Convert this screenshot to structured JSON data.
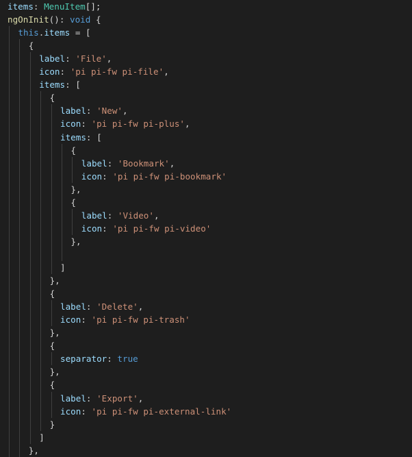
{
  "editor": {
    "language": "typescript",
    "theme": "dark",
    "lines": [
      {
        "indent": 0,
        "tokens": [
          {
            "t": "items",
            "c": "prop"
          },
          {
            "t": ": ",
            "c": "punc"
          },
          {
            "t": "MenuItem",
            "c": "type"
          },
          {
            "t": "[];",
            "c": "punc"
          }
        ]
      },
      {
        "indent": 0,
        "tokens": [
          {
            "t": "ngOnInit",
            "c": "func"
          },
          {
            "t": "(): ",
            "c": "punc"
          },
          {
            "t": "void",
            "c": "kw"
          },
          {
            "t": " {",
            "c": "punc"
          }
        ]
      },
      {
        "indent": 1,
        "tokens": [
          {
            "t": "this",
            "c": "kw"
          },
          {
            "t": ".",
            "c": "punc"
          },
          {
            "t": "items",
            "c": "prop"
          },
          {
            "t": " = [",
            "c": "punc"
          }
        ]
      },
      {
        "indent": 2,
        "tokens": [
          {
            "t": "{",
            "c": "punc"
          }
        ]
      },
      {
        "indent": 3,
        "tokens": [
          {
            "t": "label",
            "c": "prop"
          },
          {
            "t": ": ",
            "c": "punc"
          },
          {
            "t": "'File'",
            "c": "str"
          },
          {
            "t": ",",
            "c": "punc"
          }
        ]
      },
      {
        "indent": 3,
        "tokens": [
          {
            "t": "icon",
            "c": "prop"
          },
          {
            "t": ": ",
            "c": "punc"
          },
          {
            "t": "'pi pi-fw pi-file'",
            "c": "str"
          },
          {
            "t": ",",
            "c": "punc"
          }
        ]
      },
      {
        "indent": 3,
        "tokens": [
          {
            "t": "items",
            "c": "prop"
          },
          {
            "t": ": [",
            "c": "punc"
          }
        ]
      },
      {
        "indent": 4,
        "tokens": [
          {
            "t": "{",
            "c": "punc"
          }
        ]
      },
      {
        "indent": 5,
        "tokens": [
          {
            "t": "label",
            "c": "prop"
          },
          {
            "t": ": ",
            "c": "punc"
          },
          {
            "t": "'New'",
            "c": "str"
          },
          {
            "t": ",",
            "c": "punc"
          }
        ]
      },
      {
        "indent": 5,
        "tokens": [
          {
            "t": "icon",
            "c": "prop"
          },
          {
            "t": ": ",
            "c": "punc"
          },
          {
            "t": "'pi pi-fw pi-plus'",
            "c": "str"
          },
          {
            "t": ",",
            "c": "punc"
          }
        ]
      },
      {
        "indent": 5,
        "tokens": [
          {
            "t": "items",
            "c": "prop"
          },
          {
            "t": ": [",
            "c": "punc"
          }
        ]
      },
      {
        "indent": 6,
        "tokens": [
          {
            "t": "{",
            "c": "punc"
          }
        ]
      },
      {
        "indent": 7,
        "tokens": [
          {
            "t": "label",
            "c": "prop"
          },
          {
            "t": ": ",
            "c": "punc"
          },
          {
            "t": "'Bookmark'",
            "c": "str"
          },
          {
            "t": ",",
            "c": "punc"
          }
        ]
      },
      {
        "indent": 7,
        "tokens": [
          {
            "t": "icon",
            "c": "prop"
          },
          {
            "t": ": ",
            "c": "punc"
          },
          {
            "t": "'pi pi-fw pi-bookmark'",
            "c": "str"
          }
        ]
      },
      {
        "indent": 6,
        "tokens": [
          {
            "t": "},",
            "c": "punc"
          }
        ]
      },
      {
        "indent": 6,
        "tokens": [
          {
            "t": "{",
            "c": "punc"
          }
        ]
      },
      {
        "indent": 7,
        "tokens": [
          {
            "t": "label",
            "c": "prop"
          },
          {
            "t": ": ",
            "c": "punc"
          },
          {
            "t": "'Video'",
            "c": "str"
          },
          {
            "t": ",",
            "c": "punc"
          }
        ]
      },
      {
        "indent": 7,
        "tokens": [
          {
            "t": "icon",
            "c": "prop"
          },
          {
            "t": ": ",
            "c": "punc"
          },
          {
            "t": "'pi pi-fw pi-video'",
            "c": "str"
          }
        ]
      },
      {
        "indent": 6,
        "tokens": [
          {
            "t": "},",
            "c": "punc"
          }
        ]
      },
      {
        "indent": 6,
        "tokens": []
      },
      {
        "indent": 5,
        "tokens": [
          {
            "t": "]",
            "c": "punc"
          }
        ]
      },
      {
        "indent": 4,
        "tokens": [
          {
            "t": "},",
            "c": "punc"
          }
        ]
      },
      {
        "indent": 4,
        "tokens": [
          {
            "t": "{",
            "c": "punc"
          }
        ]
      },
      {
        "indent": 5,
        "tokens": [
          {
            "t": "label",
            "c": "prop"
          },
          {
            "t": ": ",
            "c": "punc"
          },
          {
            "t": "'Delete'",
            "c": "str"
          },
          {
            "t": ",",
            "c": "punc"
          }
        ]
      },
      {
        "indent": 5,
        "tokens": [
          {
            "t": "icon",
            "c": "prop"
          },
          {
            "t": ": ",
            "c": "punc"
          },
          {
            "t": "'pi pi-fw pi-trash'",
            "c": "str"
          }
        ]
      },
      {
        "indent": 4,
        "tokens": [
          {
            "t": "},",
            "c": "punc"
          }
        ]
      },
      {
        "indent": 4,
        "tokens": [
          {
            "t": "{",
            "c": "punc"
          }
        ]
      },
      {
        "indent": 5,
        "tokens": [
          {
            "t": "separator",
            "c": "prop"
          },
          {
            "t": ": ",
            "c": "punc"
          },
          {
            "t": "true",
            "c": "bool"
          }
        ]
      },
      {
        "indent": 4,
        "tokens": [
          {
            "t": "},",
            "c": "punc"
          }
        ]
      },
      {
        "indent": 4,
        "tokens": [
          {
            "t": "{",
            "c": "punc"
          }
        ]
      },
      {
        "indent": 5,
        "tokens": [
          {
            "t": "label",
            "c": "prop"
          },
          {
            "t": ": ",
            "c": "punc"
          },
          {
            "t": "'Export'",
            "c": "str"
          },
          {
            "t": ",",
            "c": "punc"
          }
        ]
      },
      {
        "indent": 5,
        "tokens": [
          {
            "t": "icon",
            "c": "prop"
          },
          {
            "t": ": ",
            "c": "punc"
          },
          {
            "t": "'pi pi-fw pi-external-link'",
            "c": "str"
          }
        ]
      },
      {
        "indent": 4,
        "tokens": [
          {
            "t": "}",
            "c": "punc"
          }
        ]
      },
      {
        "indent": 3,
        "tokens": [
          {
            "t": "]",
            "c": "punc"
          }
        ]
      },
      {
        "indent": 2,
        "tokens": [
          {
            "t": "},",
            "c": "punc"
          }
        ]
      }
    ]
  }
}
